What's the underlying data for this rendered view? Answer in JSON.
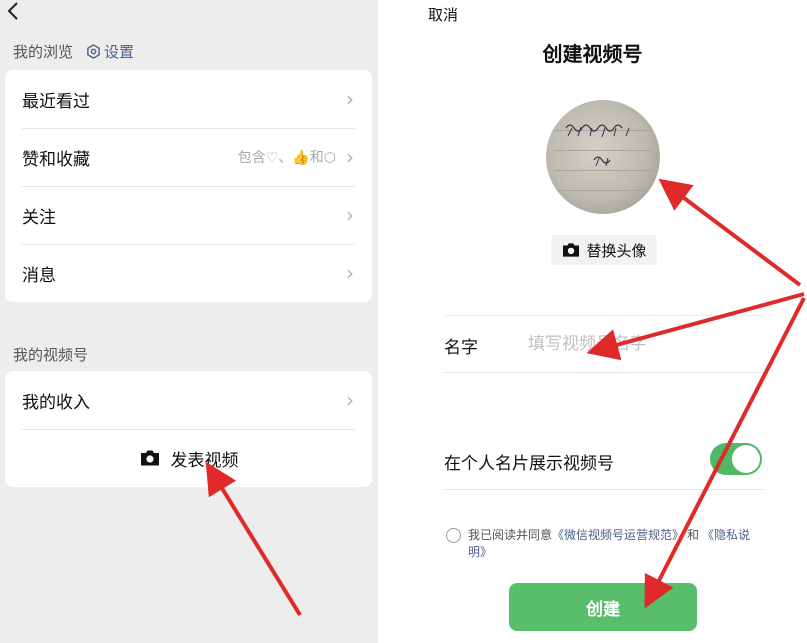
{
  "left": {
    "back_icon": "back-chevron-icon",
    "browse_title": "我的浏览",
    "settings_label": "设置",
    "browse_items": [
      {
        "label": "最近看过",
        "hint": ""
      },
      {
        "label": "赞和收藏",
        "hint": "包含♡、👍和⬡"
      },
      {
        "label": "关注",
        "hint": ""
      },
      {
        "label": "消息",
        "hint": ""
      }
    ],
    "channels_title": "我的视频号",
    "income_label": "我的收入",
    "publish_label": "发表视频"
  },
  "right": {
    "cancel_label": "取消",
    "title": "创建视频号",
    "replace_avatar_label": "替换头像",
    "name_label": "名字",
    "name_placeholder": "填写视频号名字",
    "show_on_card_label": "在个人名片展示视频号",
    "show_on_card_enabled": true,
    "agree_prefix": "我已阅读并同意",
    "policy_ops": "《微信视频号运营规范》",
    "agree_and": "和",
    "policy_privacy": "《隐私说明》",
    "create_label": "创建"
  },
  "colors": {
    "accent_green": "#58be6c",
    "link_blue": "#4a5f8c",
    "annotation_red": "#e02a2a"
  }
}
